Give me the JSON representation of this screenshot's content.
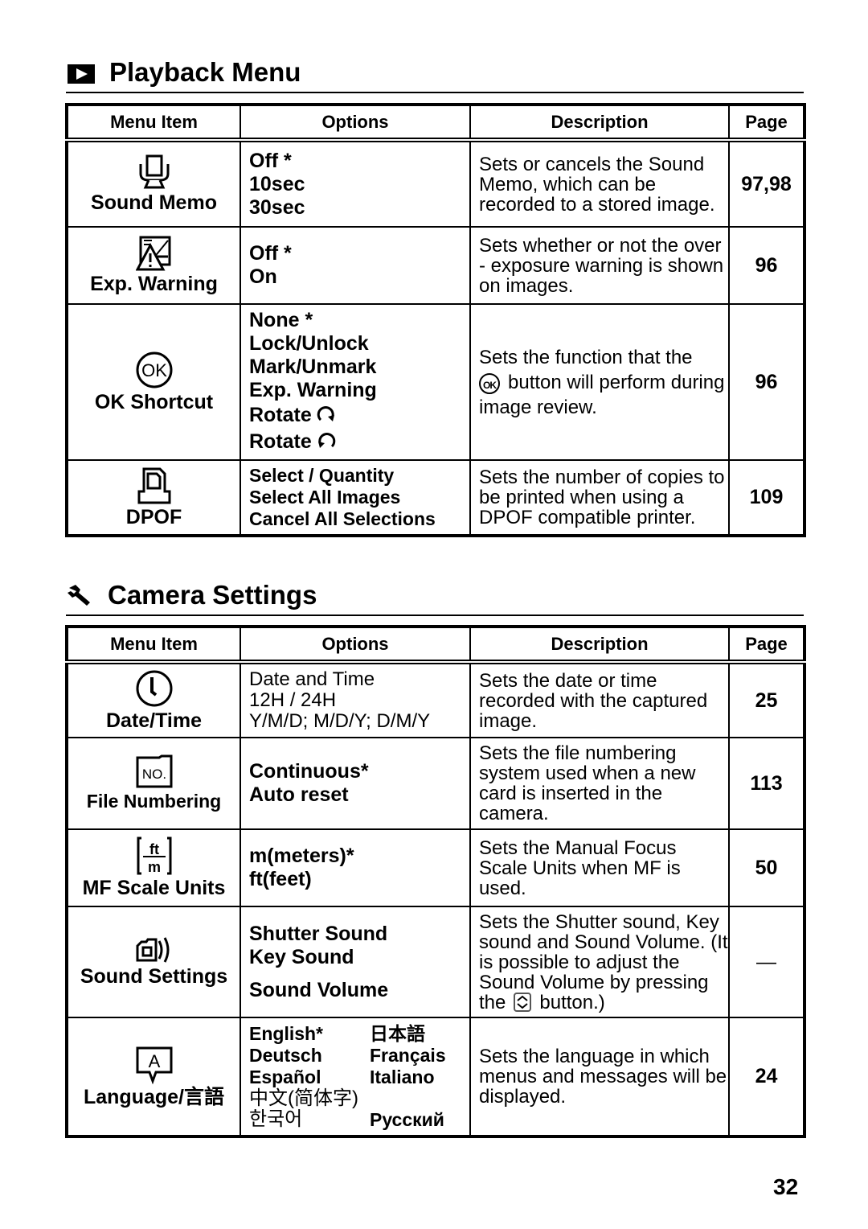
{
  "playback": {
    "title": "Playback Menu",
    "icon": "playback-icon",
    "headers": {
      "item": "Menu Item",
      "options": "Options",
      "description": "Description",
      "page": "Page"
    },
    "rows": [
      {
        "icon": "sound-memo-icon",
        "item": "Sound Memo",
        "options": [
          "Off *",
          "10sec",
          "30sec"
        ],
        "description": "Sets or cancels the Sound Memo, which can be recorded to a stored image.",
        "page": "97,98"
      },
      {
        "icon": "exposure-warning-icon",
        "item": "Exp. Warning",
        "options": [
          "Off *",
          "On"
        ],
        "description": "Sets whether or not the over - exposure warning is shown on images.",
        "page": "96"
      },
      {
        "icon": "ok-button-icon",
        "item": "OK Shortcut",
        "options": [
          "None *",
          "Lock/Unlock",
          "Mark/Unmark",
          "Exp. Warning",
          "Rotate",
          "Rotate"
        ],
        "option_icons": {
          "4": "rotate-clockwise-icon",
          "5": "rotate-counterclockwise-icon"
        },
        "description_pre": "Sets the function that the",
        "description_icon": "ok-button-icon",
        "description_icon_text": "OK",
        "description_post": "button will perform during image review.",
        "page": "96"
      },
      {
        "icon": "dpof-icon",
        "item": "DPOF",
        "options": [
          "Select / Quantity",
          "Select All Images",
          "Cancel All Selections"
        ],
        "description": "Sets the number of copies to be printed when using a DPOF compatible printer.",
        "page": "109"
      }
    ]
  },
  "camera": {
    "title": "Camera Settings",
    "icon": "wrench-icon",
    "headers": {
      "item": "Menu Item",
      "options": "Options",
      "description": "Description",
      "page": "Page"
    },
    "rows": [
      {
        "icon": "clock-icon",
        "item": "Date/Time",
        "options": [
          "Date and Time",
          "12H / 24H",
          "Y/M/D; M/D/Y; D/M/Y"
        ],
        "description": "Sets the date or time recorded with the captured image.",
        "page": "25"
      },
      {
        "icon": "file-number-icon",
        "item": "File Numbering",
        "options": [
          "Continuous*",
          "Auto reset"
        ],
        "description": "Sets the file numbering system used when a new card is inserted in the camera.",
        "page": "113"
      },
      {
        "icon": "mf-scale-units-icon",
        "item": "MF Scale Units",
        "options": [
          "m(meters)*",
          "ft(feet)"
        ],
        "description": "Sets the Manual Focus Scale Units when MF is used.",
        "page": "50"
      },
      {
        "icon": "sound-settings-icon",
        "item": "Sound Settings",
        "options": [
          "Shutter Sound",
          "Key Sound",
          "Sound Volume"
        ],
        "description_pre": "Sets the Shutter sound, Key sound and Sound Volume. (It is possible to adjust the Sound Volume by pressing the",
        "description_icon": "up-down-button-icon",
        "description_post": "button.)",
        "page": "—"
      },
      {
        "icon": "language-icon",
        "item": "Language/言語",
        "options": [
          [
            "English*",
            "日本語"
          ],
          [
            "Deutsch",
            "Français"
          ],
          [
            "Español",
            "Italiano"
          ],
          [
            "中文(简体字)",
            ""
          ],
          [
            "한국어",
            "Русский"
          ]
        ],
        "description": "Sets the language in which menus and messages will be displayed.",
        "page": "24"
      }
    ]
  },
  "page_number": "32"
}
